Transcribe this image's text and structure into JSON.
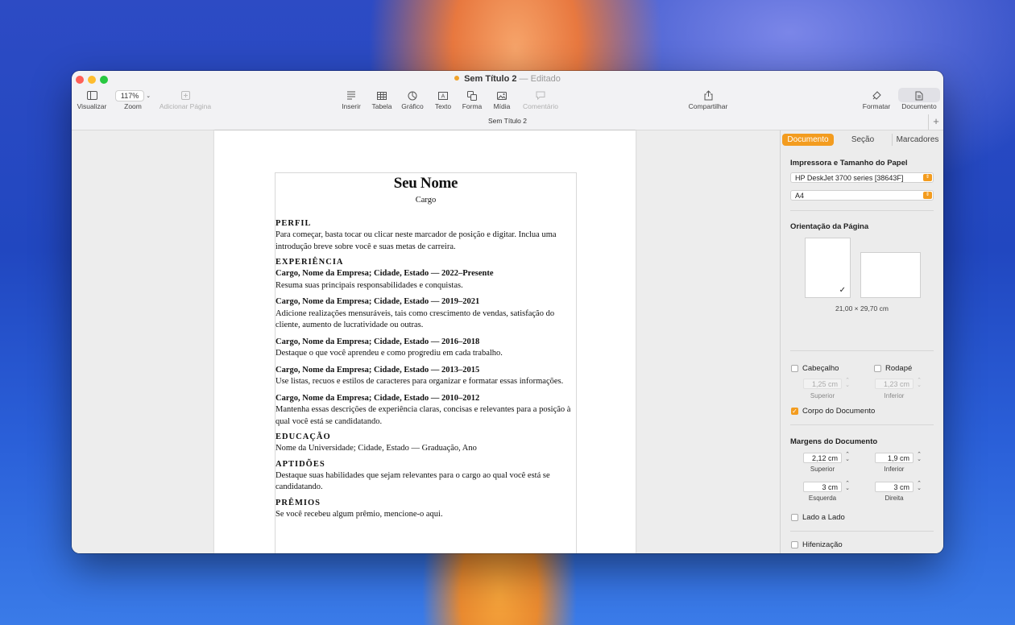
{
  "window": {
    "title": "Sem Título 2",
    "title_separator": "—",
    "title_status": "Editado",
    "tab_label": "Sem Título 2",
    "new_tab_label": "+"
  },
  "toolbar": {
    "visualizar": "Visualizar",
    "zoom_value": "117%",
    "zoom": "Zoom",
    "adicionar_pagina": "Adicionar Página",
    "inserir": "Inserir",
    "tabela": "Tabela",
    "grafico": "Gráfico",
    "texto": "Texto",
    "forma": "Forma",
    "midia": "Mídia",
    "comentario": "Comentário",
    "compartilhar": "Compartilhar",
    "formatar": "Formatar",
    "documento": "Documento"
  },
  "resume": {
    "name": "Seu Nome",
    "role": "Cargo",
    "perfil_heading": "PERFIL",
    "perfil_text": "Para começar, basta tocar ou clicar neste marcador de posição e digitar. Inclua uma introdução breve sobre você e suas metas de carreira.",
    "experiencia_heading": "EXPERIÊNCIA",
    "jobs": [
      {
        "title": "Cargo, Nome da Empresa; Cidade, Estado — 2022–Presente",
        "desc": "Resuma suas principais responsabilidades e conquistas."
      },
      {
        "title": "Cargo, Nome da Empresa; Cidade, Estado — 2019–2021",
        "desc": "Adicione realizações mensuráveis, tais como crescimento de vendas, satisfação do cliente, aumento de lucratividade ou outras."
      },
      {
        "title": "Cargo, Nome da Empresa; Cidade, Estado — 2016–2018",
        "desc": "Destaque o que você aprendeu e como progrediu em cada trabalho."
      },
      {
        "title": "Cargo, Nome da Empresa; Cidade, Estado — 2013–2015",
        "desc": "Use listas, recuos e estilos de caracteres para organizar e formatar essas informações."
      },
      {
        "title": "Cargo, Nome da Empresa; Cidade, Estado — 2010–2012",
        "desc": "Mantenha essas descrições de experiência claras, concisas e relevantes para a posição à qual você está se candidatando."
      }
    ],
    "educacao_heading": "EDUCAÇÃO",
    "educacao_text": "Nome da Universidade; Cidade, Estado — Graduação, Ano",
    "aptidoes_heading": "APTIDÕES",
    "aptidoes_text": "Destaque suas habilidades que sejam relevantes para o cargo ao qual você está se candidatando.",
    "premios_heading": "PRÊMIOS",
    "premios_text": "Se você recebeu algum prêmio, mencione-o aqui."
  },
  "sidebar": {
    "tabs": [
      "Documento",
      "Seção",
      "Marcadores"
    ],
    "active_tab": "Documento",
    "printer_heading": "Impressora e Tamanho do Papel",
    "printer_value": "HP DeskJet 3700 series [38643F]",
    "paper_value": "A4",
    "orientation_heading": "Orientação da Página",
    "selected_orientation": "portrait",
    "check_glyph": "✓",
    "paper_size": "21,00 × 29,70 cm",
    "header_label": "Cabeçalho",
    "header_checked": false,
    "footer_label": "Rodapé",
    "footer_checked": false,
    "header_value": "1,25 cm",
    "footer_value": "1,23 cm",
    "superior_label": "Superior",
    "inferior_label": "Inferior",
    "body_label": "Corpo do Documento",
    "body_checked": true,
    "margins_heading": "Margens do Documento",
    "margin_top": "2,12 cm",
    "margin_bottom": "1,9 cm",
    "margin_left": "3 cm",
    "margin_right": "3 cm",
    "esquerda_label": "Esquerda",
    "direita_label": "Direita",
    "side_by_side_label": "Lado a Lado",
    "side_by_side_checked": false,
    "hyphenation_label": "Hifenização",
    "hyphenation_checked": false
  },
  "colors": {
    "accent": "#f39c1f",
    "close": "#fe5f57",
    "minimize": "#febc2e",
    "maximize": "#28c840"
  }
}
